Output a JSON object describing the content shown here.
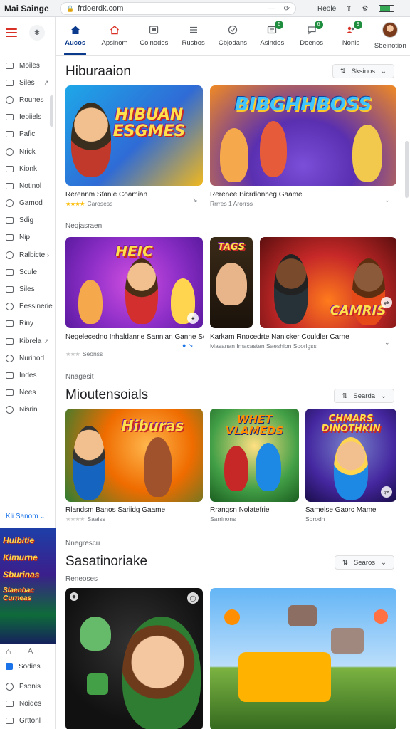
{
  "browser": {
    "title": "Mai Sainge",
    "url": "frdoerdk.com",
    "right_label": "Reole"
  },
  "sidebar": {
    "items": [
      {
        "label": "Moiles",
        "chevron": ""
      },
      {
        "label": "Siles",
        "chevron": "↗"
      },
      {
        "label": "Rounes",
        "chevron": ""
      },
      {
        "label": "Iepiiels",
        "chevron": ""
      },
      {
        "label": "Pafic",
        "chevron": ""
      },
      {
        "label": "Nrick",
        "chevron": ""
      },
      {
        "label": "Kionk",
        "chevron": ""
      },
      {
        "label": "Notinol",
        "chevron": ""
      },
      {
        "label": "Gamod",
        "chevron": ""
      },
      {
        "label": "Sdig",
        "chevron": ""
      },
      {
        "label": "Nip",
        "chevron": ""
      },
      {
        "label": "Ralbicte",
        "chevron": "›"
      },
      {
        "label": "Scule",
        "chevron": ""
      },
      {
        "label": "Siles",
        "chevron": ""
      },
      {
        "label": "Eessinerie",
        "chevron": ""
      },
      {
        "label": "Riny",
        "chevron": ""
      },
      {
        "label": "Kibrela",
        "chevron": "↗"
      },
      {
        "label": "Nurinod",
        "chevron": ""
      },
      {
        "label": "Indes",
        "chevron": ""
      },
      {
        "label": "Nees",
        "chevron": ""
      },
      {
        "label": "Nisrin",
        "chevron": ""
      }
    ],
    "promo_label": "Kli Sanom",
    "promo_text": [
      "Hulbitie",
      "Kimurne",
      "Sburinas",
      "Slaenbac Curneas"
    ],
    "bottom_items": [
      "Sodies",
      "Psonis",
      "Noides",
      "Grttonl"
    ]
  },
  "topnav": {
    "tabs": [
      {
        "label": "Aucos",
        "icon": "home-icon",
        "active": true,
        "badge": ""
      },
      {
        "label": "Apsinom",
        "icon": "house-icon",
        "active": false,
        "badge": ""
      },
      {
        "label": "Coinodes",
        "icon": "image-icon",
        "active": false,
        "badge": ""
      },
      {
        "label": "Rusbos",
        "icon": "list-icon",
        "active": false,
        "badge": ""
      },
      {
        "label": "Cbjodans",
        "icon": "check-circle-icon",
        "active": false,
        "badge": ""
      },
      {
        "label": "Asindos",
        "icon": "inbox-icon",
        "active": false,
        "badge": "5"
      },
      {
        "label": "Doenos",
        "icon": "chat-icon",
        "active": false,
        "badge": "6"
      },
      {
        "label": "Nonis",
        "icon": "people-icon",
        "active": false,
        "badge": "9"
      },
      {
        "label": "Sbeinotion",
        "icon": "avatar",
        "active": false,
        "badge": ""
      }
    ]
  },
  "sections": {
    "s1": {
      "heading": "Hiburaaion",
      "button": "Sksinos",
      "cards": [
        {
          "image_text": "HIBUAN ESGMES",
          "title": "Rerennm Sfanie Coamian",
          "meta": "Carosess",
          "rating": 4
        },
        {
          "image_text": "BIBGHHBOSS",
          "title": "Rerenee Bicrdionheg Gaame",
          "meta": "Rrrres 1  Arorrss",
          "rating": 0
        }
      ]
    },
    "s2": {
      "subheading": "Neqjasraen",
      "cards": [
        {
          "image_text": "HEIC",
          "title": "Negelecedno Inhaldanrie Sannian Ganne Seaons",
          "meta": "Seonss",
          "rating": 3
        },
        {
          "image_text": "TAGS",
          "title": "",
          "meta": "",
          "rating": 0
        },
        {
          "image_text": "CAMRIS",
          "title": "Karkam Rnocedrte Nanicker Couldler Carne",
          "meta": "Masanan Imacasten Saeshion Soorlgss",
          "rating": 0
        }
      ]
    },
    "s3": {
      "subheading": "Nnagesit",
      "heading": "Mioutensoials",
      "button": "Searda",
      "cards": [
        {
          "image_text": "Hiburas",
          "title": "Rlandsm Banos Sariidg Gaame",
          "meta": "Saaiss",
          "rating": 4
        },
        {
          "image_text": "WHET VLAMEDS",
          "title": "Rrangsn Nolatefrie",
          "meta": "Sarrinons",
          "rating": 0
        },
        {
          "image_text": "CHMARS DINOTHKIN",
          "title": "Samelse Gaorc Mame",
          "meta": "Sorodn",
          "rating": 0
        }
      ]
    },
    "s4": {
      "subheading": "Nnegrescu",
      "heading": "Sasatinoriake",
      "button": "Searos",
      "subheading2": "Reneoses",
      "cards": [
        {
          "image_text": "",
          "title": "",
          "meta": "",
          "rating": 0
        },
        {
          "image_text": "",
          "title": "",
          "meta": "",
          "rating": 0
        }
      ]
    }
  },
  "colors": {
    "accent": "#0b3a8c",
    "hamburger": "#d93025",
    "star": "#fbbc04",
    "badge": "#1e8e3e"
  }
}
